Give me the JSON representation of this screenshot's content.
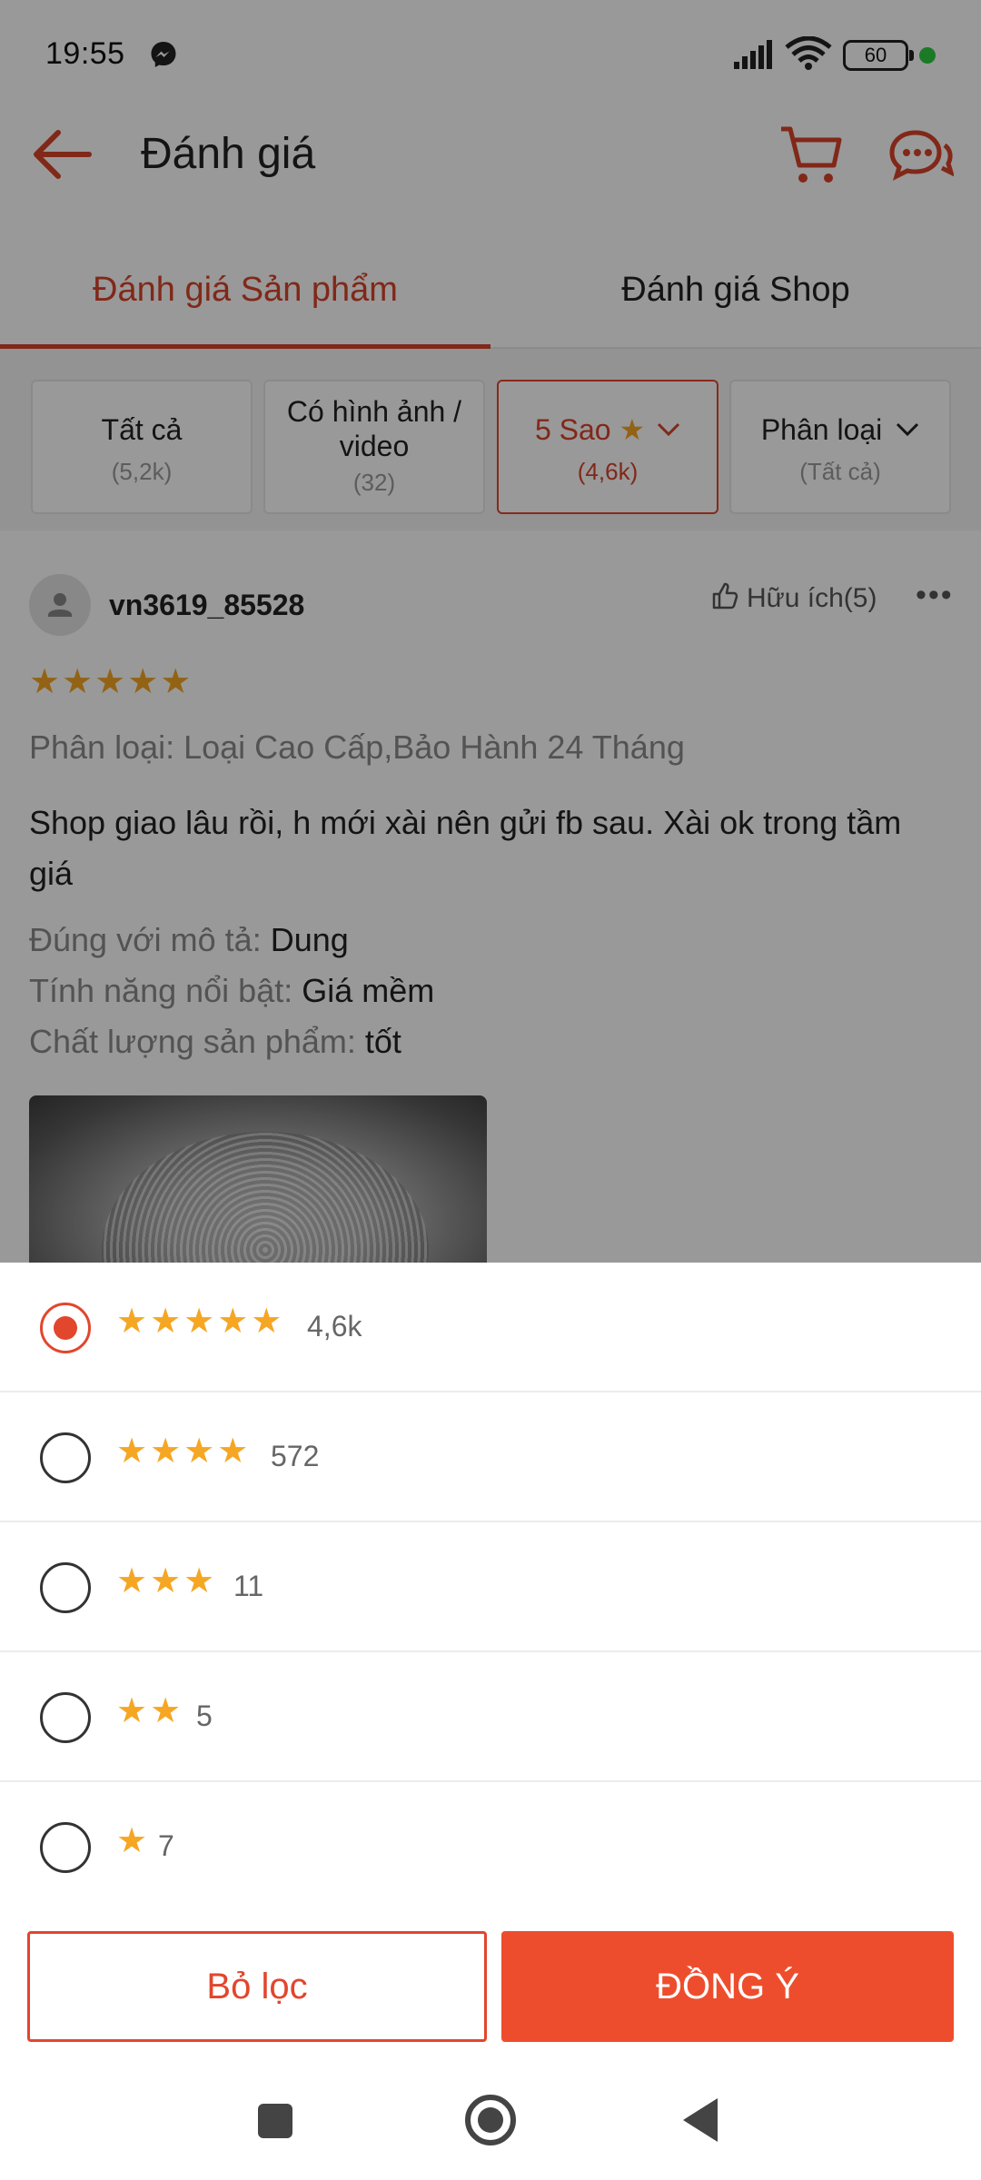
{
  "status_bar": {
    "time": "19:55",
    "battery": "60"
  },
  "header": {
    "title": "Đánh giá"
  },
  "tabs": [
    {
      "label": "Đánh giá Sản phẩm",
      "active": true
    },
    {
      "label": "Đánh giá Shop",
      "active": false
    }
  ],
  "filters": [
    {
      "label": "Tất cả",
      "count": "(5,2k)"
    },
    {
      "label": "Có hình ảnh / video",
      "count": "(32)"
    },
    {
      "label": "5 Sao",
      "count": "(4,6k)",
      "selected": true
    },
    {
      "label": "Phân loại",
      "count": "(Tất cả)"
    }
  ],
  "review": {
    "username": "vn3619_85528",
    "helpful": "Hữu ích(5)",
    "rating_stars": "★★★★★",
    "variation": "Phân loại: Loại Cao Cấp,Bảo Hành 24 Tháng",
    "text": "Shop giao lâu rồi, h mới xài nên gửi fb sau. Xài ok trong tầm giá",
    "attributes": [
      {
        "key": "Đúng với mô tả: ",
        "value": "Dung"
      },
      {
        "key": "Tính năng nổi bật: ",
        "value": "Giá mềm"
      },
      {
        "key": "Chất lượng sản phẩm: ",
        "value": "tốt"
      }
    ]
  },
  "sheet": {
    "options": [
      {
        "stars": "★★★★★",
        "count": "4,6k",
        "checked": true
      },
      {
        "stars": "★★★★",
        "count": "572",
        "checked": false
      },
      {
        "stars": "★★★",
        "count": "11",
        "checked": false
      },
      {
        "stars": "★★",
        "count": "5",
        "checked": false
      },
      {
        "stars": "★",
        "count": "7",
        "checked": false
      }
    ],
    "reset_label": "Bỏ lọc",
    "confirm_label": "ĐỒNG Ý"
  },
  "colors": {
    "accent": "#ee4d2d",
    "star": "#f5a623",
    "scrim": "rgba(0,0,0,0.4)"
  },
  "icons": [
    "messenger-icon",
    "signal-icon",
    "wifi-icon",
    "back-arrow-icon",
    "cart-icon",
    "chat-icon",
    "thumbs-up-icon",
    "more-icon",
    "star-icon",
    "chevron-down-icon",
    "avatar-icon"
  ]
}
